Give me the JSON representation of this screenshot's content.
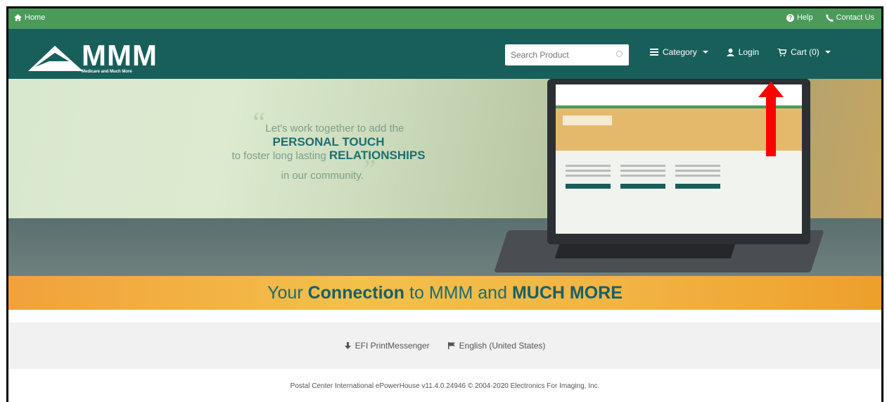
{
  "topbar": {
    "home": "Home",
    "help": "Help",
    "contact": "Contact Us"
  },
  "header": {
    "logo_text": "MMM",
    "logo_tagline": "Medicare and Much More",
    "search_placeholder": "Search Product",
    "category": "Category",
    "login": "Login",
    "cart": "Cart (0)"
  },
  "banner": {
    "line1": "Let's work together to add the",
    "line2": "PERSONAL TOUCH",
    "line3a": "to foster long lasting",
    "line3b": "RELATIONSHIPS",
    "line4": "in our community."
  },
  "stripe": {
    "p1": "Your",
    "p2": "Connection",
    "p3": "to MMM and",
    "p4": "MUCH MORE"
  },
  "footer": {
    "printmessenger": "EFI PrintMessenger",
    "language": "English (United States)",
    "copyright": "Postal Center International ePowerHouse  v11.4.0.24946  © 2004-2020 Electronics For Imaging, Inc."
  },
  "colors": {
    "topbar": "#4c9a5a",
    "navbar": "#185f5b",
    "accent_arrow": "#ff0000",
    "stripe": "#f2b443"
  }
}
